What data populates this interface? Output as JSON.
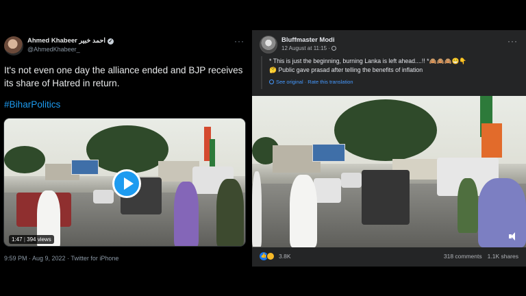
{
  "twitter": {
    "author_name": "Ahmed Khabeer احمد خبیر",
    "author_handle": "@AhmedKhabeer_",
    "more_label": "···",
    "tweet_text": "It's not even one day the alliance ended and BJP receives its share of Hatred in return.",
    "hashtag": "#BiharPolitics",
    "video_duration": "1:47",
    "video_views": "394 views",
    "timestamp": "9:59 PM · Aug 9, 2022 · Twitter for iPhone",
    "accent_color": "#1d9bf0"
  },
  "facebook": {
    "author_name": "Bluffmaster Modi",
    "post_time": "12 August at 11:15 ·",
    "more_label": "···",
    "line1": "* This is just the beginning, burning Lanka is left ahead....!! *🙈🙈🙈😁👇",
    "line2": "🤔 Public gave prasad after telling the benefits of inflation",
    "see_original": "See original · Rate this translation",
    "reaction_count": "3.8K",
    "comments": "318 comments",
    "shares": "1.1K shares",
    "accent_color": "#1877f2"
  }
}
